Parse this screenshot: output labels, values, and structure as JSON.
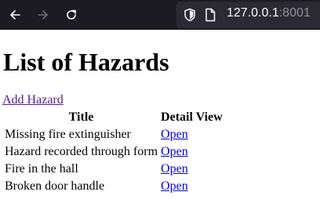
{
  "browser": {
    "back_icon": "arrow-left-icon",
    "forward_icon": "arrow-right-icon",
    "reload_icon": "reload-icon",
    "tracking_icon": "shield-icon",
    "page_icon": "page-icon",
    "url_host": "127.0.0.1",
    "url_port": ":8001",
    "toolbar_color": "#1c1b22",
    "urlbar_color": "#2b2a33"
  },
  "page": {
    "title": "List of Hazards",
    "add_link": "Add Hazard",
    "table": {
      "headers": [
        "Title",
        "Detail View"
      ],
      "rows": [
        {
          "title": "Missing fire extinguisher",
          "link": "Open"
        },
        {
          "title": "Hazard recorded through form",
          "link": "Open"
        },
        {
          "title": "Fire in the hall",
          "link": "Open"
        },
        {
          "title": "Broken door handle",
          "link": "Open"
        }
      ]
    },
    "visited_link_color": "#551a8b",
    "link_color": "#0000ee"
  }
}
